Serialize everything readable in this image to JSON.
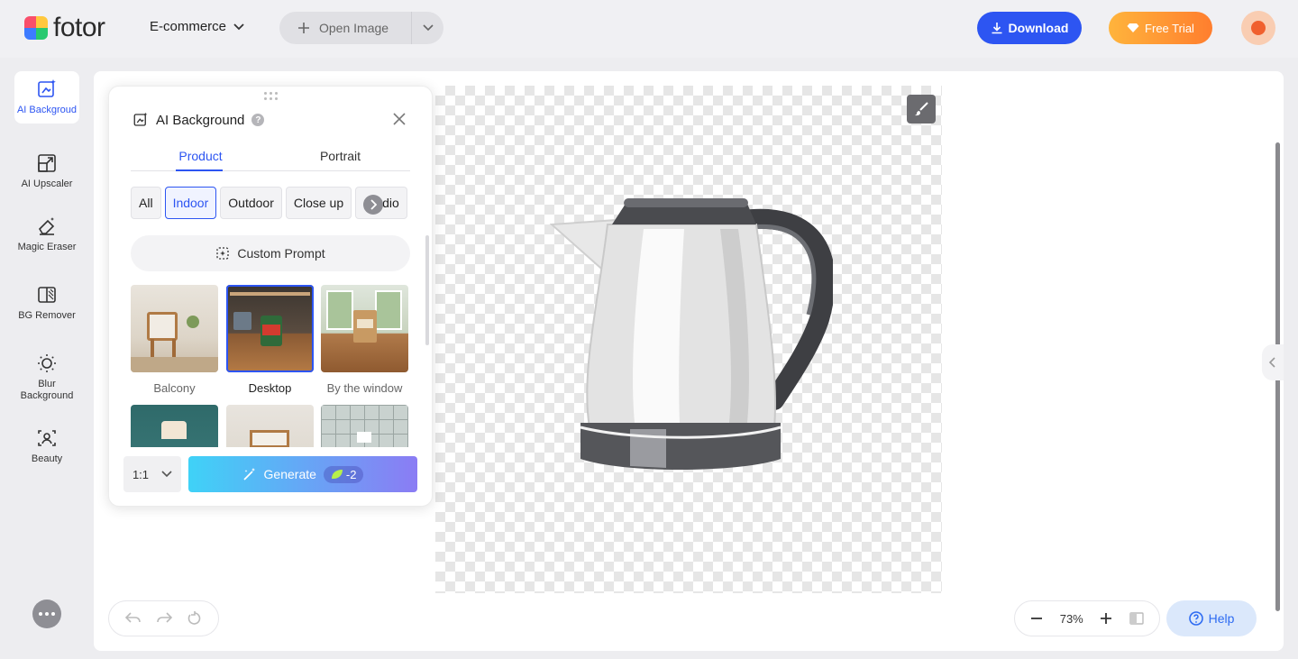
{
  "app": {
    "brand": "fotor",
    "menu_label": "E-commerce",
    "open_image_label": "Open Image",
    "download_label": "Download",
    "free_trial_label": "Free Trial"
  },
  "colors": {
    "accent": "#2d55f2",
    "trial_start": "#ffb43c",
    "trial_end": "#ff7e2e",
    "generate_start": "#3fd2f7",
    "generate_end": "#8b7cf4"
  },
  "rail": {
    "items": [
      {
        "label": "AI Backgroud",
        "icon": "ai-background-icon"
      },
      {
        "label": "AI Upscaler",
        "icon": "upscale-icon"
      },
      {
        "label": "Magic Eraser",
        "icon": "eraser-icon"
      },
      {
        "label": "BG Remover",
        "icon": "bg-remover-icon"
      },
      {
        "label": "Blur Background",
        "icon": "blur-icon"
      },
      {
        "label": "Beauty",
        "icon": "face-icon"
      }
    ]
  },
  "panel": {
    "title": "AI Background",
    "tabs": [
      "Product",
      "Portrait"
    ],
    "chips": [
      "All",
      "Indoor",
      "Outdoor",
      "Close up",
      "Studio"
    ],
    "custom_prompt_label": "Custom Prompt",
    "thumbnails": [
      {
        "caption": "Balcony"
      },
      {
        "caption": "Desktop"
      },
      {
        "caption": "By the window"
      }
    ],
    "ratio_value": "1:1",
    "generate_label": "Generate",
    "credit_cost": "-2"
  },
  "canvas": {
    "zoom": "73%",
    "help_label": "Help"
  }
}
